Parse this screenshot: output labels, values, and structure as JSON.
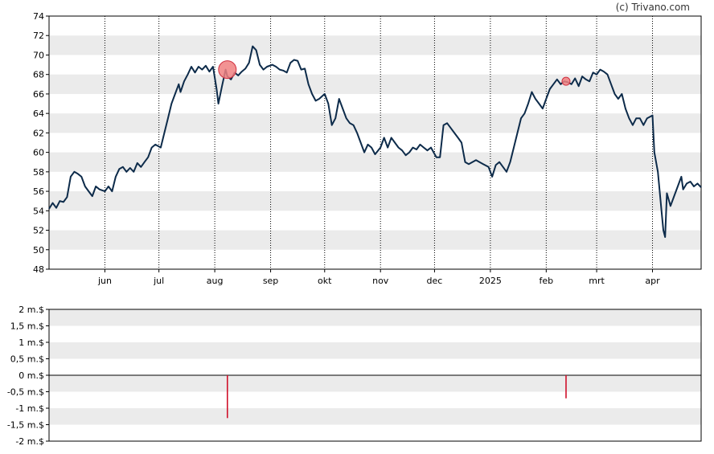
{
  "credit": "(c) Trivano.com",
  "colors": {
    "line": "#0d2b4a",
    "band": "#ebebeb",
    "marker_fill": "#f08080",
    "marker_stroke": "#d03040",
    "volume_bar": "#d0102a"
  },
  "chart_data": [
    {
      "type": "line",
      "title": "",
      "xlabel": "",
      "ylabel": "",
      "ylim": [
        48,
        74
      ],
      "yticks": [
        48,
        50,
        52,
        54,
        56,
        58,
        60,
        62,
        64,
        66,
        68,
        70,
        72,
        74
      ],
      "grid": "horizontal alternating bands, dotted vertical lines at month ticks",
      "xrange": [
        "2024-05-01",
        "2025-04-28"
      ],
      "xticks": [
        {
          "label": "jun",
          "date": "2024-06-01"
        },
        {
          "label": "jul",
          "date": "2024-07-01"
        },
        {
          "label": "aug",
          "date": "2024-08-01"
        },
        {
          "label": "sep",
          "date": "2024-09-01"
        },
        {
          "label": "okt",
          "date": "2024-10-01"
        },
        {
          "label": "nov",
          "date": "2024-11-01"
        },
        {
          "label": "dec",
          "date": "2024-12-01"
        },
        {
          "label": "2025",
          "date": "2025-01-01"
        },
        {
          "label": "feb",
          "date": "2025-02-01"
        },
        {
          "label": "mrt",
          "date": "2025-03-01"
        },
        {
          "label": "apr",
          "date": "2025-04-01"
        }
      ],
      "series": [
        {
          "points": [
            [
              "2024-05-01",
              54.2
            ],
            [
              "2024-05-03",
              54.8
            ],
            [
              "2024-05-05",
              54.3
            ],
            [
              "2024-05-07",
              55.0
            ],
            [
              "2024-05-09",
              54.9
            ],
            [
              "2024-05-11",
              55.4
            ],
            [
              "2024-05-13",
              57.5
            ],
            [
              "2024-05-15",
              58.0
            ],
            [
              "2024-05-17",
              57.8
            ],
            [
              "2024-05-19",
              57.5
            ],
            [
              "2024-05-21",
              56.5
            ],
            [
              "2024-05-23",
              56.0
            ],
            [
              "2024-05-25",
              55.5
            ],
            [
              "2024-05-27",
              56.5
            ],
            [
              "2024-05-29",
              56.2
            ],
            [
              "2024-06-01",
              56.0
            ],
            [
              "2024-06-03",
              56.5
            ],
            [
              "2024-06-05",
              56.0
            ],
            [
              "2024-06-07",
              57.5
            ],
            [
              "2024-06-09",
              58.3
            ],
            [
              "2024-06-11",
              58.5
            ],
            [
              "2024-06-13",
              58.0
            ],
            [
              "2024-06-15",
              58.4
            ],
            [
              "2024-06-17",
              58.0
            ],
            [
              "2024-06-19",
              58.9
            ],
            [
              "2024-06-21",
              58.5
            ],
            [
              "2024-06-23",
              59.0
            ],
            [
              "2024-06-25",
              59.5
            ],
            [
              "2024-06-27",
              60.5
            ],
            [
              "2024-06-29",
              60.8
            ],
            [
              "2024-07-02",
              60.5
            ],
            [
              "2024-07-04",
              62.0
            ],
            [
              "2024-07-06",
              63.5
            ],
            [
              "2024-07-08",
              65.0
            ],
            [
              "2024-07-10",
              66.0
            ],
            [
              "2024-07-12",
              67.0
            ],
            [
              "2024-07-13",
              66.2
            ],
            [
              "2024-07-15",
              67.3
            ],
            [
              "2024-07-17",
              68.0
            ],
            [
              "2024-07-19",
              68.8
            ],
            [
              "2024-07-21",
              68.2
            ],
            [
              "2024-07-23",
              68.8
            ],
            [
              "2024-07-25",
              68.5
            ],
            [
              "2024-07-27",
              68.9
            ],
            [
              "2024-07-29",
              68.3
            ],
            [
              "2024-07-31",
              68.8
            ],
            [
              "2024-08-02",
              66.5
            ],
            [
              "2024-08-03",
              65.0
            ],
            [
              "2024-08-05",
              66.8
            ],
            [
              "2024-08-07",
              68.5
            ],
            [
              "2024-08-08",
              67.8
            ],
            [
              "2024-08-10",
              67.5
            ],
            [
              "2024-08-12",
              68.2
            ],
            [
              "2024-08-14",
              67.9
            ],
            [
              "2024-08-16",
              68.3
            ],
            [
              "2024-08-18",
              68.6
            ],
            [
              "2024-08-20",
              69.2
            ],
            [
              "2024-08-22",
              70.9
            ],
            [
              "2024-08-24",
              70.5
            ],
            [
              "2024-08-26",
              69.0
            ],
            [
              "2024-08-28",
              68.5
            ],
            [
              "2024-08-30",
              68.8
            ],
            [
              "2024-09-02",
              69.0
            ],
            [
              "2024-09-04",
              68.8
            ],
            [
              "2024-09-06",
              68.5
            ],
            [
              "2024-09-08",
              68.4
            ],
            [
              "2024-09-10",
              68.2
            ],
            [
              "2024-09-12",
              69.2
            ],
            [
              "2024-09-14",
              69.5
            ],
            [
              "2024-09-16",
              69.4
            ],
            [
              "2024-09-18",
              68.5
            ],
            [
              "2024-09-20",
              68.6
            ],
            [
              "2024-09-22",
              67.0
            ],
            [
              "2024-09-24",
              66.0
            ],
            [
              "2024-09-26",
              65.3
            ],
            [
              "2024-09-28",
              65.5
            ],
            [
              "2024-10-01",
              66.0
            ],
            [
              "2024-10-03",
              65.0
            ],
            [
              "2024-10-05",
              62.8
            ],
            [
              "2024-10-07",
              63.5
            ],
            [
              "2024-10-09",
              65.5
            ],
            [
              "2024-10-11",
              64.5
            ],
            [
              "2024-10-13",
              63.5
            ],
            [
              "2024-10-15",
              63.0
            ],
            [
              "2024-10-17",
              62.8
            ],
            [
              "2024-10-19",
              62.0
            ],
            [
              "2024-10-21",
              61.0
            ],
            [
              "2024-10-23",
              60.0
            ],
            [
              "2024-10-25",
              60.8
            ],
            [
              "2024-10-27",
              60.5
            ],
            [
              "2024-10-29",
              59.8
            ],
            [
              "2024-11-01",
              60.5
            ],
            [
              "2024-11-03",
              61.5
            ],
            [
              "2024-11-05",
              60.5
            ],
            [
              "2024-11-07",
              61.5
            ],
            [
              "2024-11-09",
              61.0
            ],
            [
              "2024-11-11",
              60.5
            ],
            [
              "2024-11-13",
              60.2
            ],
            [
              "2024-11-15",
              59.7
            ],
            [
              "2024-11-17",
              60.0
            ],
            [
              "2024-11-19",
              60.5
            ],
            [
              "2024-11-21",
              60.3
            ],
            [
              "2024-11-23",
              60.8
            ],
            [
              "2024-11-25",
              60.5
            ],
            [
              "2024-11-27",
              60.2
            ],
            [
              "2024-11-29",
              60.5
            ],
            [
              "2024-12-02",
              59.5
            ],
            [
              "2024-12-04",
              59.5
            ],
            [
              "2024-12-06",
              62.8
            ],
            [
              "2024-12-08",
              63.0
            ],
            [
              "2024-12-10",
              62.5
            ],
            [
              "2024-12-12",
              62.0
            ],
            [
              "2024-12-14",
              61.5
            ],
            [
              "2024-12-16",
              61.0
            ],
            [
              "2024-12-18",
              59.0
            ],
            [
              "2024-12-20",
              58.8
            ],
            [
              "2024-12-22",
              59.0
            ],
            [
              "2024-12-24",
              59.2
            ],
            [
              "2024-12-26",
              59.0
            ],
            [
              "2024-12-28",
              58.8
            ],
            [
              "2024-12-31",
              58.5
            ],
            [
              "2025-01-02",
              57.5
            ],
            [
              "2025-01-04",
              58.7
            ],
            [
              "2025-01-06",
              59.0
            ],
            [
              "2025-01-08",
              58.5
            ],
            [
              "2025-01-10",
              58.0
            ],
            [
              "2025-01-12",
              59.0
            ],
            [
              "2025-01-14",
              60.5
            ],
            [
              "2025-01-16",
              62.0
            ],
            [
              "2025-01-18",
              63.5
            ],
            [
              "2025-01-20",
              64.0
            ],
            [
              "2025-01-22",
              65.0
            ],
            [
              "2025-01-24",
              66.2
            ],
            [
              "2025-01-26",
              65.5
            ],
            [
              "2025-01-28",
              65.0
            ],
            [
              "2025-01-30",
              64.5
            ],
            [
              "2025-02-01",
              65.5
            ],
            [
              "2025-02-03",
              66.5
            ],
            [
              "2025-02-05",
              67.0
            ],
            [
              "2025-02-07",
              67.5
            ],
            [
              "2025-02-09",
              67.0
            ],
            [
              "2025-02-11",
              67.3
            ],
            [
              "2025-02-13",
              67.2
            ],
            [
              "2025-02-15",
              67.0
            ],
            [
              "2025-02-17",
              67.6
            ],
            [
              "2025-02-19",
              66.8
            ],
            [
              "2025-02-21",
              67.8
            ],
            [
              "2025-02-23",
              67.5
            ],
            [
              "2025-02-25",
              67.3
            ],
            [
              "2025-02-27",
              68.2
            ],
            [
              "2025-03-01",
              68.0
            ],
            [
              "2025-03-03",
              68.5
            ],
            [
              "2025-03-05",
              68.3
            ],
            [
              "2025-03-07",
              68.0
            ],
            [
              "2025-03-09",
              67.0
            ],
            [
              "2025-03-11",
              66.0
            ],
            [
              "2025-03-13",
              65.5
            ],
            [
              "2025-03-15",
              66.0
            ],
            [
              "2025-03-17",
              64.5
            ],
            [
              "2025-03-19",
              63.5
            ],
            [
              "2025-03-21",
              62.8
            ],
            [
              "2025-03-23",
              63.5
            ],
            [
              "2025-03-25",
              63.5
            ],
            [
              "2025-03-27",
              62.8
            ],
            [
              "2025-03-29",
              63.5
            ],
            [
              "2025-04-01",
              63.8
            ],
            [
              "2025-04-02",
              60.0
            ],
            [
              "2025-04-04",
              58.0
            ],
            [
              "2025-04-06",
              54.0
            ],
            [
              "2025-04-07",
              52.0
            ],
            [
              "2025-04-08",
              51.3
            ],
            [
              "2025-04-09",
              55.8
            ],
            [
              "2025-04-11",
              54.5
            ],
            [
              "2025-04-13",
              55.5
            ],
            [
              "2025-04-15",
              56.5
            ],
            [
              "2025-04-17",
              57.5
            ],
            [
              "2025-04-18",
              56.2
            ],
            [
              "2025-04-20",
              56.8
            ],
            [
              "2025-04-22",
              57.0
            ],
            [
              "2025-04-24",
              56.5
            ],
            [
              "2025-04-26",
              56.8
            ],
            [
              "2025-04-28",
              56.4
            ]
          ]
        }
      ],
      "annotations": [
        {
          "date": "2024-08-08",
          "value": 68.5,
          "size": "large"
        },
        {
          "date": "2025-02-12",
          "value": 67.3,
          "size": "small"
        }
      ]
    },
    {
      "type": "bar",
      "title": "",
      "xlabel": "",
      "ylabel": "",
      "ylim": [
        -2,
        2
      ],
      "yticks": [
        {
          "value": 2,
          "label": "2 m.$"
        },
        {
          "value": 1.5,
          "label": "1,5 m.$"
        },
        {
          "value": 1,
          "label": "1 m.$"
        },
        {
          "value": 0.5,
          "label": "0,5 m.$"
        },
        {
          "value": 0,
          "label": "0 m.$"
        },
        {
          "value": -0.5,
          "label": "-0,5 m.$"
        },
        {
          "value": -1,
          "label": "-1 m.$"
        },
        {
          "value": -1.5,
          "label": "-1,5 m.$"
        },
        {
          "value": -2,
          "label": "-2 m.$"
        }
      ],
      "grid": "horizontal alternating bands",
      "values": [
        {
          "date": "2024-08-08",
          "value": -1.3
        },
        {
          "date": "2025-02-12",
          "value": -0.7
        }
      ]
    }
  ]
}
